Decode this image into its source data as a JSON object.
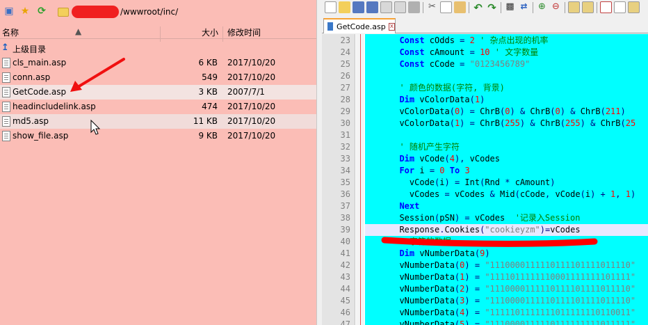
{
  "address_bar": {
    "path": "/wwwroot/inc/",
    "icons": [
      "computer-icon",
      "star-icon",
      "refresh-icon",
      "folder-icon"
    ]
  },
  "file_list": {
    "headers": {
      "name": "名称",
      "size": "大小",
      "modified": "修改时间"
    },
    "up_label": "上级目录",
    "rows": [
      {
        "name": "cls_main.asp",
        "size": "6 KB",
        "date": "2017/10/20"
      },
      {
        "name": "conn.asp",
        "size": "549",
        "date": "2017/10/20"
      },
      {
        "name": "GetCode.asp",
        "size": "3 KB",
        "date": "2007/7/1"
      },
      {
        "name": "headincludelink.asp",
        "size": "474",
        "date": "2017/10/20"
      },
      {
        "name": "md5.asp",
        "size": "11 KB",
        "date": "2017/10/20"
      },
      {
        "name": "show_file.asp",
        "size": "9 KB",
        "date": "2017/10/20"
      }
    ]
  },
  "editor": {
    "tab_label": "GetCode.asp",
    "tab_close": "x",
    "lines": [
      {
        "n": "23",
        "html": "  <span class=\"kw\">Const</span> cOdds <span class=\"op\">=</span> <span class=\"nm\">2</span> <span class=\"cm\">' 杂点出现的机率</span>"
      },
      {
        "n": "24",
        "html": "  <span class=\"kw\">Const</span> cAmount <span class=\"op\">=</span> <span class=\"nm\">10</span> <span class=\"cm\">' 文字数量</span>"
      },
      {
        "n": "25",
        "html": "  <span class=\"kw\">Const</span> cCode <span class=\"op\">=</span> <span class=\"st\">\"0123456789\"</span>"
      },
      {
        "n": "26",
        "html": ""
      },
      {
        "n": "27",
        "html": "  <span class=\"cm\">' 颜色的数据(字符, 背景)</span>"
      },
      {
        "n": "28",
        "html": "  <span class=\"kw\">Dim</span> vColorData<span class=\"op\">(</span><span class=\"nm\">1</span><span class=\"op\">)</span>"
      },
      {
        "n": "29",
        "html": "  vColorData<span class=\"op\">(</span><span class=\"nm\">0</span><span class=\"op\">)</span> <span class=\"op\">=</span> ChrB<span class=\"op\">(</span><span class=\"nm\">0</span><span class=\"op\">)</span> <span class=\"op\">&amp;</span> ChrB<span class=\"op\">(</span><span class=\"nm\">0</span><span class=\"op\">)</span> <span class=\"op\">&amp;</span> ChrB<span class=\"op\">(</span><span class=\"nm\">211</span><span class=\"op\">)</span>"
      },
      {
        "n": "30",
        "html": "  vColorData<span class=\"op\">(</span><span class=\"nm\">1</span><span class=\"op\">)</span> <span class=\"op\">=</span> ChrB<span class=\"op\">(</span><span class=\"nm\">255</span><span class=\"op\">)</span> <span class=\"op\">&amp;</span> ChrB<span class=\"op\">(</span><span class=\"nm\">255</span><span class=\"op\">)</span> <span class=\"op\">&amp;</span> ChrB<span class=\"op\">(</span><span class=\"nm\">25</span>"
      },
      {
        "n": "31",
        "html": ""
      },
      {
        "n": "32",
        "html": "  <span class=\"cm\">' 随机产生字符</span>"
      },
      {
        "n": "33",
        "html": "  <span class=\"kw\">Dim</span> vCode<span class=\"op\">(</span><span class=\"nm\">4</span><span class=\"op\">),</span> vCodes"
      },
      {
        "n": "34",
        "html": "  <span class=\"kw\">For</span> i <span class=\"op\">=</span> <span class=\"nm\">0</span> <span class=\"kw\">To</span> <span class=\"nm\">3</span>"
      },
      {
        "n": "35",
        "html": "    vCode<span class=\"op\">(</span>i<span class=\"op\">)</span> <span class=\"op\">=</span> Int<span class=\"op\">(</span>Rnd <span class=\"op\">*</span> cAmount<span class=\"op\">)</span>"
      },
      {
        "n": "36",
        "html": "    vCodes <span class=\"op\">=</span> vCodes <span class=\"op\">&amp;</span> Mid<span class=\"op\">(</span>cCode<span class=\"op\">,</span> vCode<span class=\"op\">(</span>i<span class=\"op\">)</span> <span class=\"op\">+</span> <span class=\"nm\">1</span><span class=\"op\">,</span> <span class=\"nm\">1</span><span class=\"op\">)</span>"
      },
      {
        "n": "37",
        "html": "  <span class=\"kw\">Next</span>"
      },
      {
        "n": "38",
        "html": "  Session<span class=\"op\">(</span>pSN<span class=\"op\">)</span> <span class=\"op\">=</span> vCodes  <span class=\"cm\">'记录入Session</span>"
      },
      {
        "n": "39",
        "html": "  Response<span class=\"op\">.</span>Cookies<span class=\"op\">(</span><span class=\"st\">\"cookieyzm\"</span><span class=\"op\">)=</span>vCodes"
      },
      {
        "n": "40",
        "html": "  <span class=\"cm\">' 字符的数据</span>"
      },
      {
        "n": "41",
        "html": "  <span class=\"kw\">Dim</span> vNumberData<span class=\"op\">(</span><span class=\"nm\">9</span><span class=\"op\">)</span>"
      },
      {
        "n": "42",
        "html": "  vNumberData<span class=\"op\">(</span><span class=\"nm\">0</span><span class=\"op\">)</span> <span class=\"op\">=</span> <span class=\"st\">\"1110000111110111101111011110\"</span>"
      },
      {
        "n": "43",
        "html": "  vNumberData<span class=\"op\">(</span><span class=\"nm\">1</span><span class=\"op\">)</span> <span class=\"op\">=</span> <span class=\"st\">\"1111011111110001111111101111\"</span>"
      },
      {
        "n": "44",
        "html": "  vNumberData<span class=\"op\">(</span><span class=\"nm\">2</span><span class=\"op\">)</span> <span class=\"op\">=</span> <span class=\"st\">\"1110000111110111101111011110\"</span>"
      },
      {
        "n": "45",
        "html": "  vNumberData<span class=\"op\">(</span><span class=\"nm\">3</span><span class=\"op\">)</span> <span class=\"op\">=</span> <span class=\"st\">\"1110000111110111101111011110\"</span>"
      },
      {
        "n": "46",
        "html": "  vNumberData<span class=\"op\">(</span><span class=\"nm\">4</span><span class=\"op\">)</span> <span class=\"op\">=</span> <span class=\"st\">\"1111101111111011111110110011\"</span>"
      },
      {
        "n": "47",
        "html": "  vNumberData<span class=\"op\">(</span><span class=\"nm\">5</span><span class=\"op\">)</span> <span class=\"op\">=</span> <span class=\"st\">\"1110000111110111111111011111\"</span>"
      }
    ]
  },
  "colors": {
    "file_panel_bg": "#fbbdb6",
    "code_bg": "#00ffff",
    "annotation_red": "#ff0000"
  }
}
